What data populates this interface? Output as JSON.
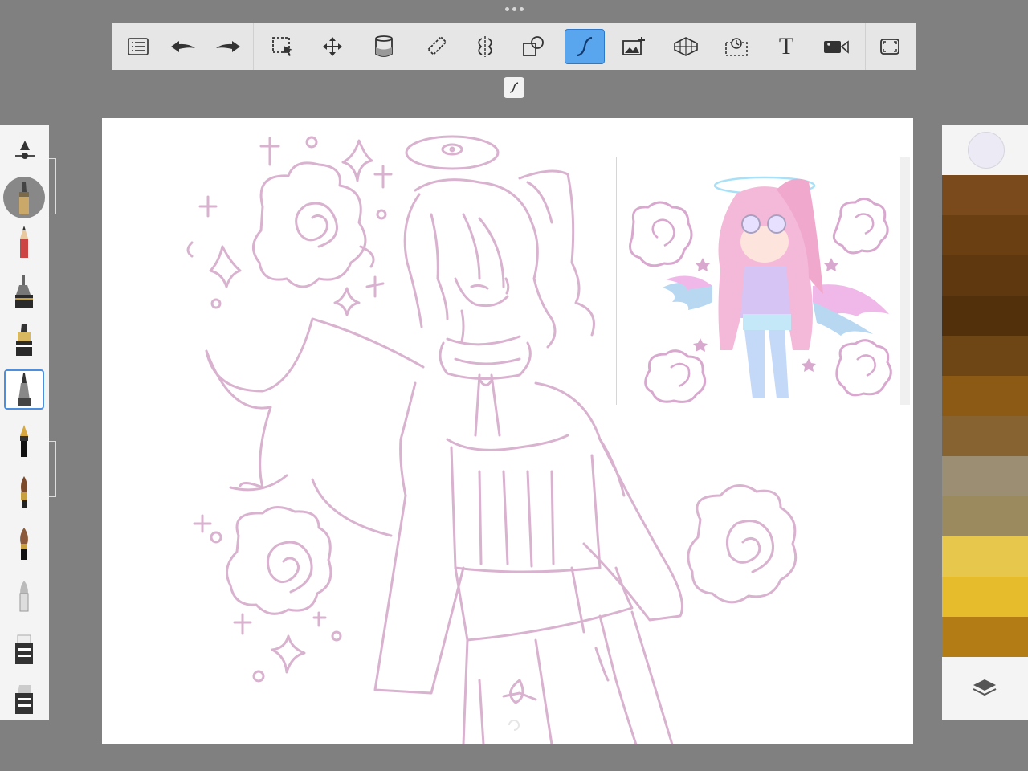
{
  "toolbar": {
    "text_tool_label": "T",
    "tools": [
      "list-icon",
      "undo-icon",
      "redo-icon",
      "selection-icon",
      "transform-icon",
      "fill-bucket-icon",
      "ruler-icon",
      "symmetry-icon",
      "shapes-icon",
      "stroke-icon",
      "add-image-icon",
      "perspective-icon",
      "time-lapse-icon",
      "text-icon",
      "video-icon",
      "fullscreen-icon"
    ],
    "active_tool": "stroke-icon"
  },
  "brushes": [
    "airbrush",
    "pencil",
    "technical-pen",
    "felt-pen",
    "paint-brush",
    "fountain-pen",
    "watercolor-brush",
    "ink-brush",
    "blender",
    "eraser",
    "marker"
  ],
  "selected_brush": "paint-brush",
  "colors": {
    "current": "#ecebf5",
    "palette": [
      "#7a4a1c",
      "#6a3f12",
      "#5f3810",
      "#53300c",
      "#6e4514",
      "#8c5a14",
      "#876331",
      "#9b8e73",
      "#9c8a5f",
      "#e8c84c",
      "#e6bc2c",
      "#b37c14"
    ],
    "stroke": "#d9b2cf"
  }
}
